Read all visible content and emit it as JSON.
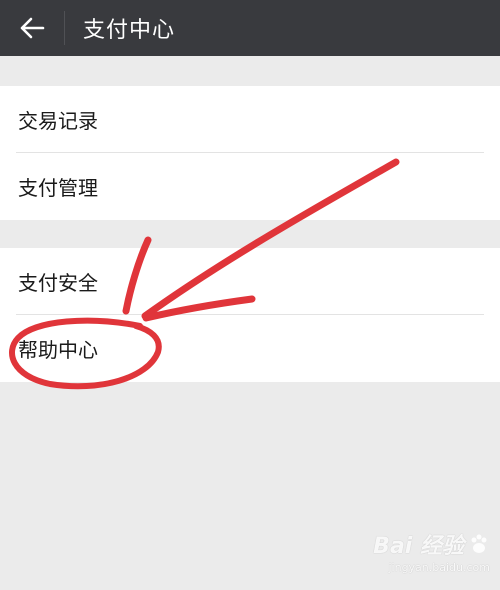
{
  "header": {
    "title": "支付中心",
    "back_icon": "arrow-left-icon",
    "background": "#393a3e"
  },
  "groups": [
    {
      "items": [
        {
          "label": "交易记录"
        },
        {
          "label": "支付管理"
        }
      ]
    },
    {
      "items": [
        {
          "label": "支付安全"
        },
        {
          "label": "帮助中心"
        }
      ]
    }
  ],
  "annotation": {
    "color": "#e0353a",
    "shapes": [
      "arrow-icon",
      "circle-icon"
    ]
  },
  "watermark": {
    "brand": "Bai  经验",
    "url": "jingyan.baidu.com"
  }
}
